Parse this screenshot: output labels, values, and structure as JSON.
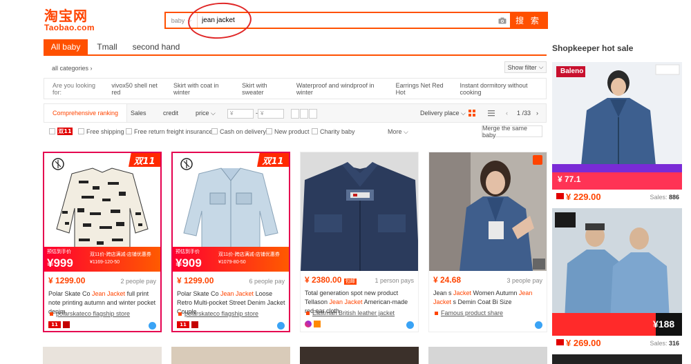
{
  "header": {
    "logo_cn": "淘宝网",
    "logo_en": "Taobao.com",
    "search_scope": "baby",
    "search_value": "jean jacket",
    "search_button": "搜 索"
  },
  "tabs": [
    "All baby",
    "Tmall",
    "second hand"
  ],
  "categories": {
    "label": "all categories",
    "show_filter": "Show filter"
  },
  "suggest": {
    "label": "Are you looking for:",
    "items": [
      "vivox50 shell net red",
      "Skirt with coat in winter",
      "Skirt with sweater",
      "Waterproof and windproof in winter",
      "Earrings Net Red Hot",
      "Instant dormitory without cooking"
    ]
  },
  "sortbar": {
    "items": [
      "Comprehensive ranking",
      "Sales",
      "credit",
      "price"
    ],
    "price_from": "¥",
    "price_to": "¥",
    "price_sep": "-",
    "delivery": "Delivery place",
    "page": "1 /33"
  },
  "filters": {
    "double11": "双11",
    "items": [
      "Free shipping",
      "Free return freight insurance",
      "Cash on delivery",
      "New product",
      "Charity baby"
    ],
    "more": "More",
    "merge": "Merge the same baby"
  },
  "products": [
    {
      "price": "¥ 1299.00",
      "pay": "2 people pay",
      "title_a": "Polar Skate Co ",
      "title_hl": "Jean Jacket",
      "title_b": " full print note printing autumn and winter pocket denim",
      "shop": "polarskateco flagship store",
      "promo_small": "预估到手价",
      "promo_price": "¥999",
      "promo_r1": "双11价-跨店满减-店铺优惠券",
      "promo_r2": "¥1169-120-50",
      "badge": "双11"
    },
    {
      "price": "¥ 1299.00",
      "pay": "6 people pay",
      "title_a": "Polar Skate Co ",
      "title_hl": "Jean Jacket",
      "title_b": " Loose Retro Multi-pocket Street Denim Jacket Couple",
      "shop": "polarskateco flagship store",
      "promo_small": "预估到手价",
      "promo_price": "¥909",
      "promo_r1": "双11价-跨店满减-店铺优惠券",
      "promo_r2": "¥1079-80-50",
      "badge": "双11"
    },
    {
      "price": "¥ 2380.00",
      "pay": "1 person pays",
      "tag": "包邮",
      "title_a": "Total generation spot new product Tellason ",
      "title_hl": "Jean Jacket",
      "title_b": " American-made red ear cloth",
      "shop": "Eastman British leather jacket"
    },
    {
      "price": "¥ 24.68",
      "pay": "3 people pay",
      "title_a": "Jean s ",
      "title_hl": "Jacket",
      "title_b": " Women Autumn ",
      "title_hl2": "Jean Jacket",
      "title_c": " s Demin Coat Bi Size",
      "shop": "Famous product share"
    }
  ],
  "hot": {
    "title": "Shopkeeper hot sale",
    "items": [
      {
        "price": "¥ 229.00",
        "sales_label": "Sales: ",
        "sales": "886",
        "brand": "Baleno",
        "promo": "¥ 77.1"
      },
      {
        "price": "¥ 269.00",
        "sales_label": "Sales: ",
        "sales": "316",
        "promo": "¥188"
      }
    ]
  }
}
